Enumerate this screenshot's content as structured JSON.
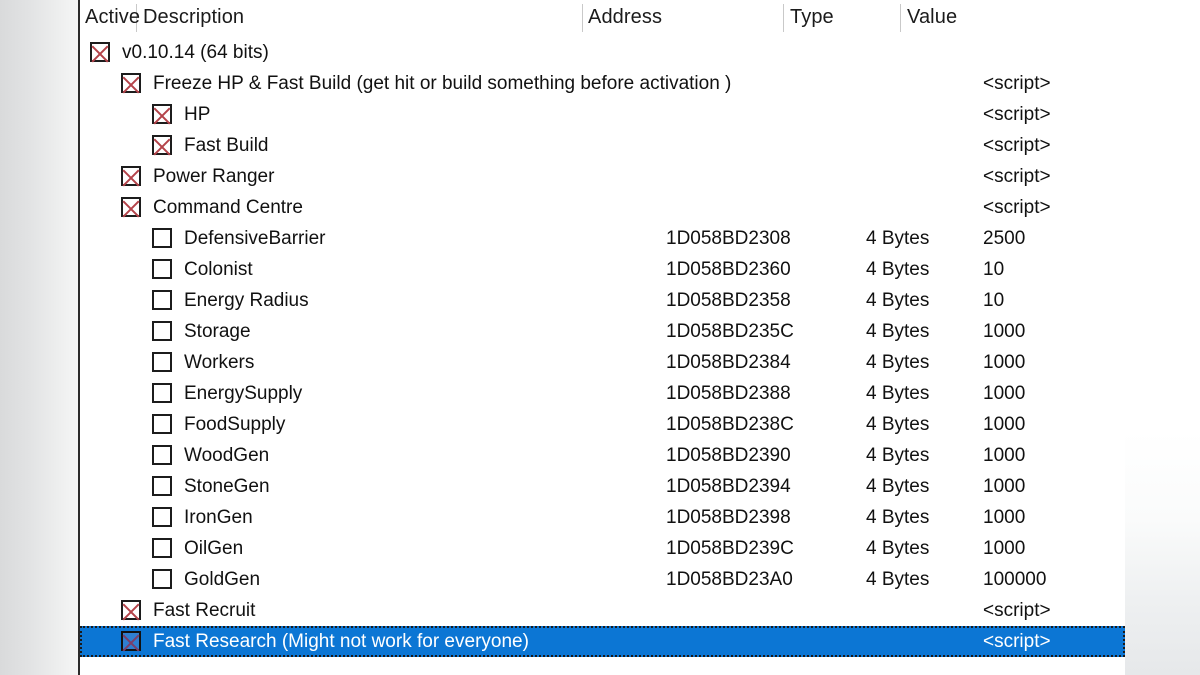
{
  "window": {
    "app": "Cheat Engine Table",
    "background_accent": "#0c76d4"
  },
  "table": {
    "columns": [
      {
        "key": "active",
        "label": "Active"
      },
      {
        "key": "description",
        "label": "Description"
      },
      {
        "key": "address",
        "label": "Address"
      },
      {
        "key": "type",
        "label": "Type"
      },
      {
        "key": "value",
        "label": "Value"
      }
    ],
    "rows": [
      {
        "active": true,
        "indent": 0,
        "description": "v0.10.14 (64 bits)",
        "address": "",
        "type": "",
        "value": "",
        "selected": false
      },
      {
        "active": true,
        "indent": 1,
        "description": "Freeze HP & Fast Build (get hit or build something before activation )",
        "address": "",
        "type": "",
        "value": "<script>",
        "selected": false
      },
      {
        "active": true,
        "indent": 2,
        "description": "HP",
        "address": "",
        "type": "",
        "value": "<script>",
        "selected": false
      },
      {
        "active": true,
        "indent": 2,
        "description": "Fast Build",
        "address": "",
        "type": "",
        "value": "<script>",
        "selected": false
      },
      {
        "active": true,
        "indent": 1,
        "description": "Power Ranger",
        "address": "",
        "type": "",
        "value": "<script>",
        "selected": false
      },
      {
        "active": true,
        "indent": 1,
        "description": "Command Centre",
        "address": "",
        "type": "",
        "value": "<script>",
        "selected": false
      },
      {
        "active": false,
        "indent": 2,
        "description": "DefensiveBarrier",
        "address": "1D058BD2308",
        "type": "4 Bytes",
        "value": "2500",
        "selected": false
      },
      {
        "active": false,
        "indent": 2,
        "description": "Colonist",
        "address": "1D058BD2360",
        "type": "4 Bytes",
        "value": "10",
        "selected": false
      },
      {
        "active": false,
        "indent": 2,
        "description": "Energy Radius",
        "address": "1D058BD2358",
        "type": "4 Bytes",
        "value": "10",
        "selected": false
      },
      {
        "active": false,
        "indent": 2,
        "description": "Storage",
        "address": "1D058BD235C",
        "type": "4 Bytes",
        "value": "1000",
        "selected": false
      },
      {
        "active": false,
        "indent": 2,
        "description": "Workers",
        "address": "1D058BD2384",
        "type": "4 Bytes",
        "value": "1000",
        "selected": false
      },
      {
        "active": false,
        "indent": 2,
        "description": "EnergySupply",
        "address": "1D058BD2388",
        "type": "4 Bytes",
        "value": "1000",
        "selected": false
      },
      {
        "active": false,
        "indent": 2,
        "description": "FoodSupply",
        "address": "1D058BD238C",
        "type": "4 Bytes",
        "value": "1000",
        "selected": false
      },
      {
        "active": false,
        "indent": 2,
        "description": "WoodGen",
        "address": "1D058BD2390",
        "type": "4 Bytes",
        "value": "1000",
        "selected": false
      },
      {
        "active": false,
        "indent": 2,
        "description": "StoneGen",
        "address": "1D058BD2394",
        "type": "4 Bytes",
        "value": "1000",
        "selected": false
      },
      {
        "active": false,
        "indent": 2,
        "description": "IronGen",
        "address": "1D058BD2398",
        "type": "4 Bytes",
        "value": "1000",
        "selected": false
      },
      {
        "active": false,
        "indent": 2,
        "description": "OilGen",
        "address": "1D058BD239C",
        "type": "4 Bytes",
        "value": "1000",
        "selected": false
      },
      {
        "active": false,
        "indent": 2,
        "description": "GoldGen",
        "address": "1D058BD23A0",
        "type": "4 Bytes",
        "value": "100000",
        "selected": false
      },
      {
        "active": true,
        "indent": 1,
        "description": "Fast Recruit",
        "address": "",
        "type": "",
        "value": "<script>",
        "selected": false
      },
      {
        "active": true,
        "indent": 1,
        "description": "Fast Research (Might not work for everyone)",
        "address": "",
        "type": "",
        "value": "<script>",
        "selected": true
      }
    ]
  }
}
